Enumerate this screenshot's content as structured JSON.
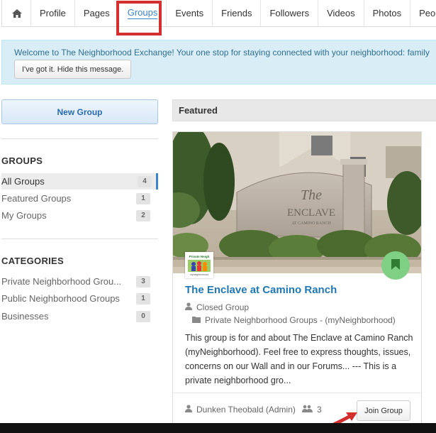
{
  "nav": {
    "items": [
      {
        "label": "Profile"
      },
      {
        "label": "Pages"
      },
      {
        "label": "Groups"
      },
      {
        "label": "Events"
      },
      {
        "label": "Friends"
      },
      {
        "label": "Followers"
      },
      {
        "label": "Videos"
      },
      {
        "label": "Photos"
      },
      {
        "label": "People"
      }
    ],
    "active": "Groups"
  },
  "banner": {
    "text": "Welcome to The Neighborhood Exchange! Your one stop for staying connected with your neighborhood: family",
    "dismiss_label": "I've got it. Hide this message."
  },
  "sidebar": {
    "new_group_label": "New Group",
    "groups_title": "GROUPS",
    "groups": [
      {
        "label": "All Groups",
        "count": "4"
      },
      {
        "label": "Featured Groups",
        "count": "1"
      },
      {
        "label": "My Groups",
        "count": "2"
      }
    ],
    "categories_title": "CATEGORIES",
    "categories": [
      {
        "label": "Private Neighborhood Grou...",
        "count": "3"
      },
      {
        "label": "Public Neighborhood Groups",
        "count": "1"
      },
      {
        "label": "Businesses",
        "count": "0"
      }
    ]
  },
  "featured": {
    "header": "Featured",
    "card": {
      "title": "The Enclave at Camino Ranch",
      "privacy": "Closed Group",
      "category": "Private Neighborhood Groups - (myNeighborhood)",
      "description": "This group is for and about The Enclave at Camino Ranch (myNeighborhood). Feel free to express thoughts, issues, concerns on our Wall and in our Forums... --- This is a private neighborhood gro...",
      "owner": "Dunken Theobald (Admin)",
      "members": "3",
      "join_label": "Join Group",
      "sign_text_line1": "The",
      "sign_text_line2": "ENCLAVE",
      "sign_text_line3": "AT CAMINO RANCH",
      "thumb_text_line1": "Private Neigh",
      "thumb_text_line2": "myneighborhood"
    }
  },
  "colors": {
    "accent": "#3a84c9",
    "highlight": "#d32f2f",
    "banner_bg": "#d9edf7",
    "bookmark": "#7fcf84"
  },
  "icons": [
    "home-icon",
    "user-icon",
    "folder-icon",
    "users-icon",
    "bookmark-icon"
  ]
}
